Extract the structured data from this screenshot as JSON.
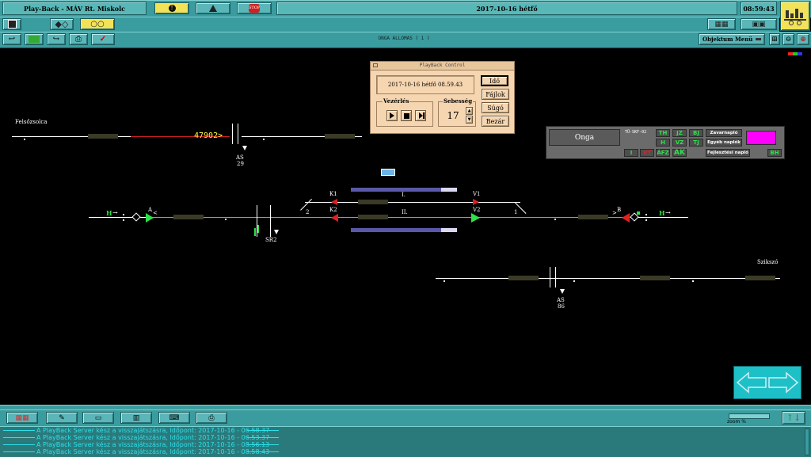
{
  "title_bar": {
    "app_title": "Play-Back - MÁV Rt. Miskolc",
    "date_text": "2017-10-16  hétfő",
    "clock": "08:59:43",
    "stop_label": "STOP"
  },
  "toolbar": {
    "station_header": "ONGA ALLOMAS ( 1 )",
    "object_menu": "Objektum Menü"
  },
  "playback": {
    "window_title": "PlayBack Control",
    "timestamp": "2017-10-16 hétfő 08.59.43",
    "control_label": "Vezérlés",
    "speed_label": "Sebesség",
    "speed_value": "17",
    "btn_time": "Idő",
    "btn_files": "Fájlok",
    "btn_help": "Súgó",
    "btn_close": "Bezár"
  },
  "status_panel": {
    "station": "Onga",
    "code": "TÜ-SKF-02",
    "row1": [
      "TH",
      "JZ",
      "BJ"
    ],
    "row2": [
      "H",
      "VZ",
      "TJ"
    ],
    "row3": [
      "I",
      "VT",
      "ÁFZ",
      "AK"
    ],
    "btn_fault": "Zavarnapló",
    "btn_other": "Egyéb naplók",
    "btn_dev": "Fejlesztési napló",
    "bh": "BH"
  },
  "track": {
    "left_station": "Felsőzsolca",
    "right_station": "Szikszó",
    "train_number": "47902>",
    "as29_a": "AS",
    "as29_b": "29",
    "as86_a": "AS",
    "as86_b": "86",
    "signal_A": "A",
    "signal_B": "B",
    "sig_A_arrow": "<",
    "sig_B_arrow": ">",
    "signal_H_left": "H",
    "signal_H_right": "H",
    "k1": "K1",
    "k2": "K2",
    "v1": "V1",
    "v2": "V2",
    "track_I": "I.",
    "track_II": "II.",
    "sw2": "2",
    "sw1": "1",
    "sr2": "SR2"
  },
  "bottom": {
    "zoom_label": "zoom %",
    "log": [
      "A PlayBack Server kész a visszajátszásra, Időpont: 2017-10-16 - 06.58.37",
      "A PlayBack Server kész a visszajátszásra, Időpont: 2017-10-16 - 06.53.37",
      "A PlayBack Server kész a visszajátszásra, Időpont: 2017-10-16 - 08.56.13",
      "A PlayBack Server kész a visszajátszásra, Időpont: 2017-10-16 - 08.58.43"
    ]
  }
}
